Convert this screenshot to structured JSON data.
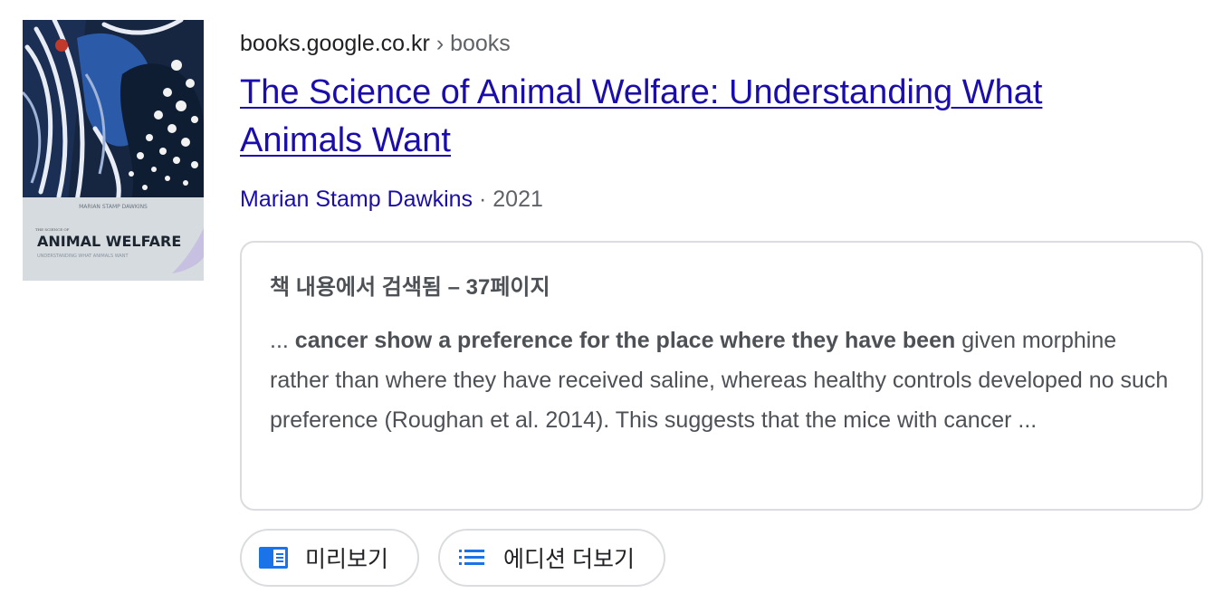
{
  "result": {
    "site": "books.google.co.kr",
    "breadcrumb_sep": "›",
    "breadcrumb_path": "books",
    "title": "The Science of Animal Welfare: Understanding What Animals Want",
    "author": "Marian Stamp Dawkins",
    "meta_sep": "·",
    "year": "2021",
    "cover": {
      "author_line": "MARIAN STAMP DAWKINS",
      "kicker": "THE SCIENCE OF",
      "title": "ANIMAL WELFARE",
      "subtitle": "UNDERSTANDING WHAT ANIMALS WANT"
    },
    "snippet": {
      "heading": "책 내용에서 검색됨 – 37페이지",
      "prefix": "... ",
      "bold": "cancer show a preference for the place where they have been",
      "rest": " given morphine rather than where they have received saline, whereas healthy controls developed no such preference (Roughan et al. 2014). This suggests that the mice with cancer ..."
    },
    "buttons": {
      "preview": {
        "label": "미리보기",
        "icon": "book-preview-icon"
      },
      "editions": {
        "label": "에디션 더보기",
        "icon": "list-icon"
      }
    }
  },
  "colors": {
    "link": "#1a0dab",
    "text": "#202124",
    "secondary": "#5f6368",
    "snippet": "#4d5156",
    "border": "#dadce0",
    "icon_blue": "#1a73e8"
  }
}
